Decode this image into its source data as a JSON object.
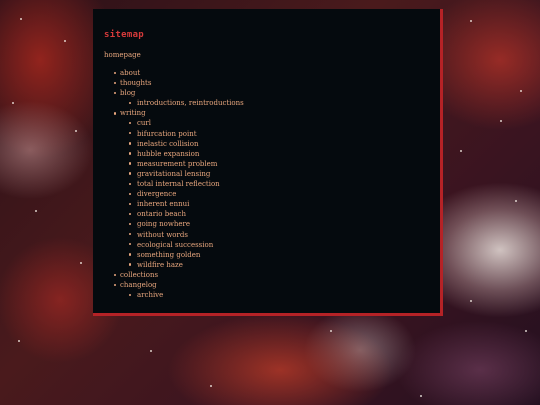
{
  "page": {
    "title": "sitemap",
    "home_link": "homepage"
  },
  "nav": {
    "about": "about",
    "thoughts": "thoughts",
    "blog": {
      "label": "blog",
      "children": [
        "introductions, reintroductions"
      ]
    },
    "writing": {
      "label": "writing",
      "children": [
        "curl",
        "bifurcation point",
        "inelastic collision",
        "hubble expansion",
        "measurement problem",
        "gravitational lensing",
        "total internal reflection",
        "divergence",
        "inherent ennui",
        "ontario beach",
        "going nowhere",
        "without words",
        "ecological succession",
        "something golden",
        "wildfire haze"
      ]
    },
    "collections": "collections",
    "changelog": {
      "label": "changelog",
      "children": [
        "archive"
      ]
    }
  },
  "colors": {
    "panel_background": "#050a0e",
    "panel_border": "#b52226",
    "title": "#d63a3a",
    "link": "#e9a77e"
  }
}
